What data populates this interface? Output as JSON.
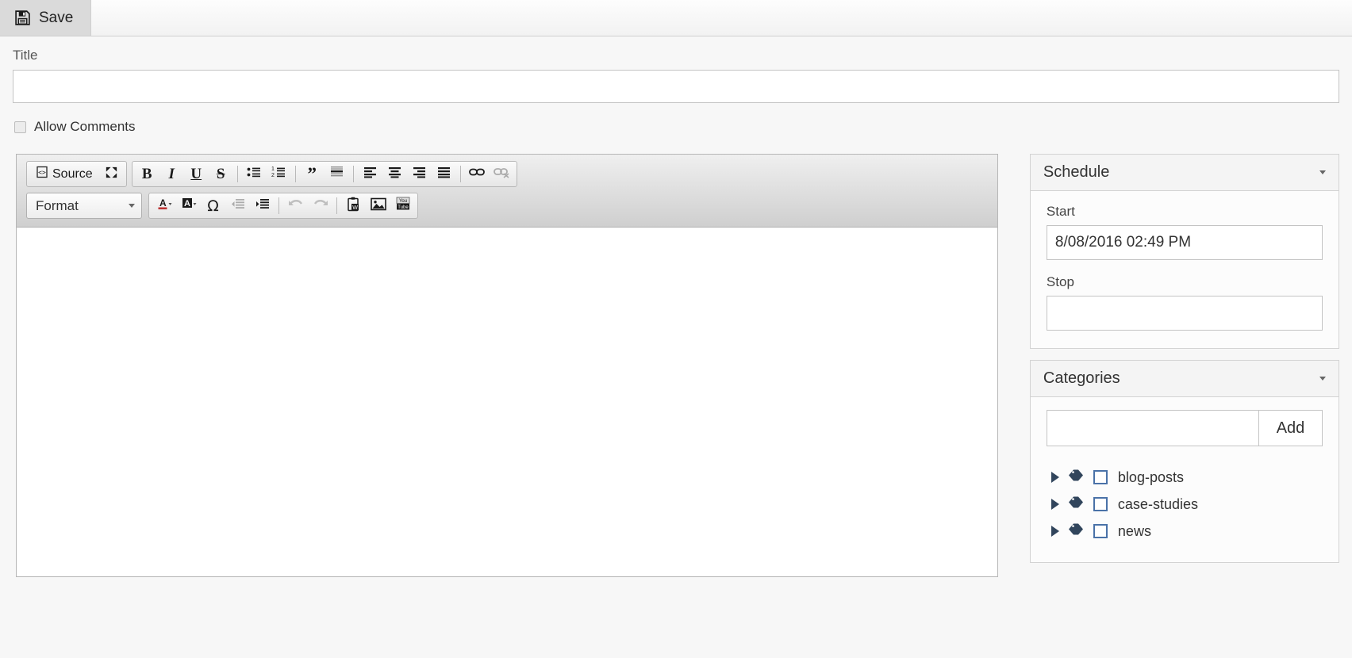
{
  "toolbar": {
    "save_label": "Save",
    "save_icon": "floppy-disk-icon"
  },
  "form": {
    "title_label": "Title",
    "title_value": "",
    "title_placeholder": "",
    "allow_comments_label": "Allow Comments",
    "allow_comments_checked": false
  },
  "editor": {
    "row1": [
      {
        "name": "source-button",
        "label": "Source",
        "icon": "source-code-icon",
        "disabled": false
      },
      {
        "name": "maximize-button",
        "label": "",
        "icon": "maximize-icon",
        "disabled": false
      },
      {
        "name": "bold-button",
        "label": "B",
        "icon": "bold-icon",
        "disabled": false
      },
      {
        "name": "italic-button",
        "label": "I",
        "icon": "italic-icon",
        "disabled": false
      },
      {
        "name": "underline-button",
        "label": "U",
        "icon": "underline-icon",
        "disabled": false
      },
      {
        "name": "strikethrough-button",
        "label": "S",
        "icon": "strikethrough-icon",
        "disabled": false
      },
      {
        "name": "bulleted-list-button",
        "label": "",
        "icon": "bulleted-list-icon",
        "disabled": false
      },
      {
        "name": "numbered-list-button",
        "label": "",
        "icon": "numbered-list-icon",
        "disabled": false
      },
      {
        "name": "blockquote-button",
        "label": "",
        "icon": "blockquote-icon",
        "disabled": false
      },
      {
        "name": "create-div-button",
        "label": "",
        "icon": "div-container-icon",
        "disabled": false
      },
      {
        "name": "align-left-button",
        "label": "",
        "icon": "align-left-icon",
        "disabled": false
      },
      {
        "name": "align-center-button",
        "label": "",
        "icon": "align-center-icon",
        "disabled": false
      },
      {
        "name": "align-right-button",
        "label": "",
        "icon": "align-right-icon",
        "disabled": false
      },
      {
        "name": "align-justify-button",
        "label": "",
        "icon": "align-justify-icon",
        "disabled": false
      },
      {
        "name": "link-button",
        "label": "",
        "icon": "link-icon",
        "disabled": false
      },
      {
        "name": "unlink-button",
        "label": "",
        "icon": "unlink-icon",
        "disabled": true
      }
    ],
    "format_label": "Format",
    "row2": [
      {
        "name": "text-color-button",
        "label": "",
        "icon": "text-color-icon",
        "disabled": false
      },
      {
        "name": "background-color-button",
        "label": "",
        "icon": "background-color-icon",
        "disabled": false
      },
      {
        "name": "special-character-button",
        "label": "",
        "icon": "omega-icon",
        "disabled": false
      },
      {
        "name": "outdent-button",
        "label": "",
        "icon": "outdent-icon",
        "disabled": true
      },
      {
        "name": "indent-button",
        "label": "",
        "icon": "indent-icon",
        "disabled": false
      },
      {
        "name": "undo-button",
        "label": "",
        "icon": "undo-icon",
        "disabled": true
      },
      {
        "name": "redo-button",
        "label": "",
        "icon": "redo-icon",
        "disabled": true
      },
      {
        "name": "paste-from-word-button",
        "label": "",
        "icon": "paste-from-word-icon",
        "disabled": false
      },
      {
        "name": "image-button",
        "label": "",
        "icon": "image-icon",
        "disabled": false
      },
      {
        "name": "youtube-button",
        "label": "",
        "icon": "youtube-icon",
        "disabled": false
      }
    ],
    "content": ""
  },
  "sidebar": {
    "schedule": {
      "title": "Schedule",
      "collapse_icon": "chevron-down-icon",
      "start_label": "Start",
      "start_value": "8/08/2016 02:49 PM",
      "stop_label": "Stop",
      "stop_value": ""
    },
    "categories": {
      "title": "Categories",
      "collapse_icon": "chevron-down-icon",
      "input_value": "",
      "add_label": "Add",
      "items": [
        {
          "label": "blog-posts",
          "checked": false
        },
        {
          "label": "case-studies",
          "checked": false
        },
        {
          "label": "news",
          "checked": false
        }
      ]
    }
  },
  "colors": {
    "tag": "#31455c",
    "checkbox_border": "#4a72a8",
    "panel_header_bg": "#f4f4f4"
  }
}
